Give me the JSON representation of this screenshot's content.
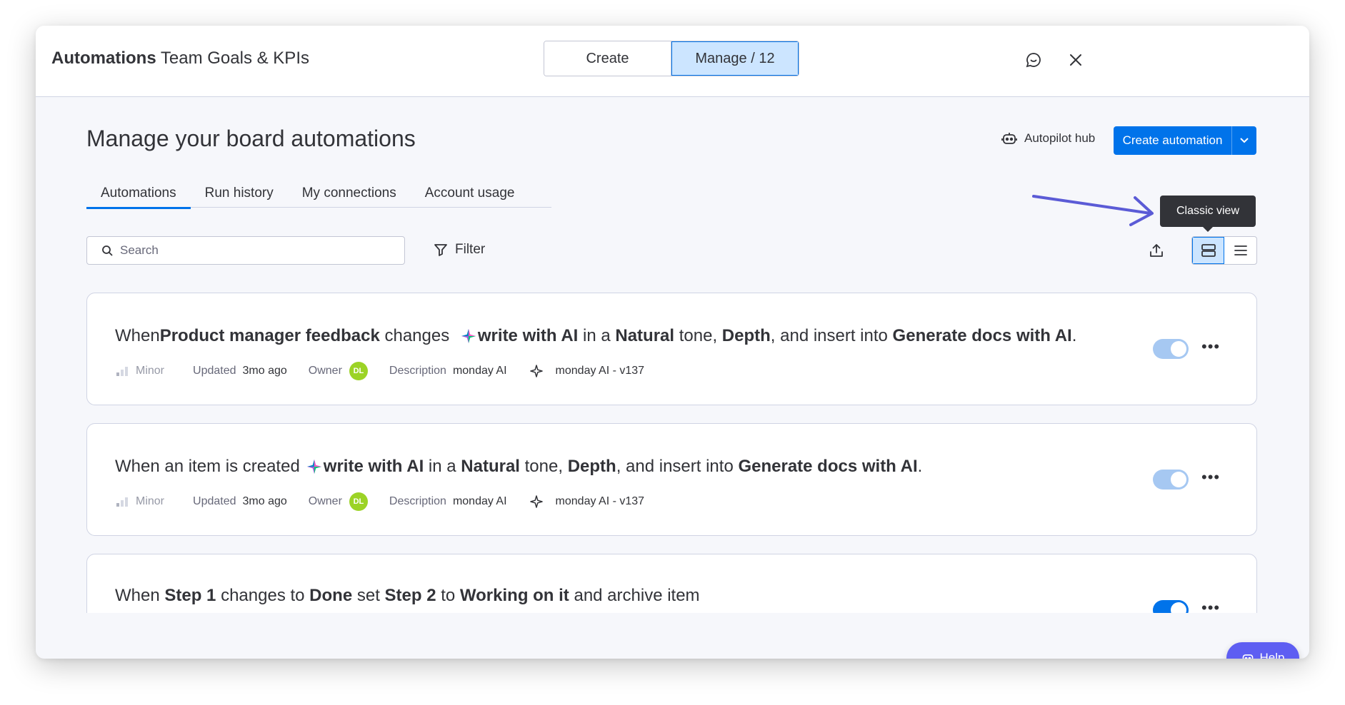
{
  "header": {
    "title_bold": "Automations",
    "title_rest": " Team Goals & KPIs",
    "seg_create": "Create",
    "seg_manage": "Manage / 12"
  },
  "main": {
    "page_title": "Manage your board automations",
    "autopilot_hub": "Autopilot hub",
    "create_automation": "Create automation",
    "tabs": [
      {
        "label": "Automations"
      },
      {
        "label": "Run history"
      },
      {
        "label": "My connections"
      },
      {
        "label": "Account usage"
      }
    ],
    "search_placeholder": "Search",
    "filter_label": "Filter",
    "tooltip": "Classic view"
  },
  "automations": [
    {
      "parts": [
        "When ",
        "Product manager feedback",
        " changes ",
        "write with AI",
        " in a ",
        "Natural",
        " tone, ",
        "Depth",
        ", and insert into ",
        "Generate docs with AI",
        "."
      ],
      "level": "Minor",
      "updated_label": "Updated",
      "updated": "3mo ago",
      "owner_label": "Owner",
      "owner_initials": "DL",
      "description_label": "Description",
      "description": "monday AI",
      "version": "monday AI - v137",
      "enabled": true
    },
    {
      "parts": [
        "When an item is created",
        "write with AI",
        " in a ",
        "Natural",
        " tone, ",
        "Depth",
        ", and insert into ",
        "Generate docs with AI",
        "."
      ],
      "level": "Minor",
      "updated_label": "Updated",
      "updated": "3mo ago",
      "owner_label": "Owner",
      "owner_initials": "DL",
      "description_label": "Description",
      "description": "monday AI",
      "version": "monday AI - v137",
      "enabled": true
    },
    {
      "parts": [
        "When ",
        "Step 1",
        " changes to ",
        "Done",
        " set ",
        "Step 2",
        " to ",
        "Working on it",
        " and archive item"
      ],
      "enabled": true
    }
  ],
  "help_label": "Help",
  "colors": {
    "primary": "#0073ea",
    "selected_bg": "#cce5ff",
    "help": "#5e5ef2",
    "arrow": "#5b5bd6",
    "avatar": "#9cd326"
  }
}
